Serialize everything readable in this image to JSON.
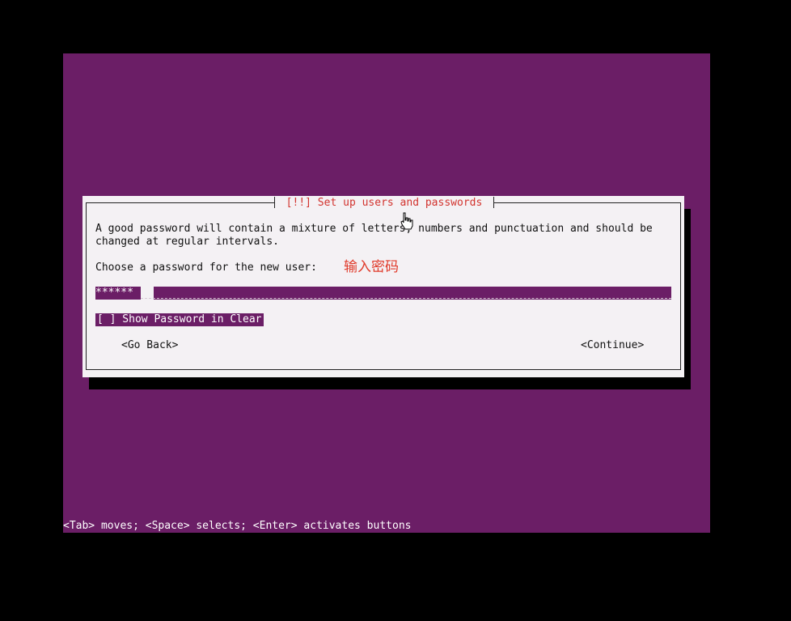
{
  "dialog": {
    "title": "[!!] Set up users and passwords",
    "description_line1": "A good password will contain a mixture of letters, numbers and punctuation and should be",
    "description_line2": "changed at regular intervals.",
    "prompt": "Choose a password for the new user:",
    "annotation": "输入密码",
    "password_value": "******",
    "show_password_label": "[ ] Show Password in Clear",
    "go_back_label": "<Go Back>",
    "continue_label": "<Continue>"
  },
  "footer": {
    "hint": "<Tab> moves; <Space> selects; <Enter> activates buttons"
  },
  "colors": {
    "background": "#6b1e66",
    "title_accent": "#d2332e",
    "annotation": "#e03a2a"
  }
}
